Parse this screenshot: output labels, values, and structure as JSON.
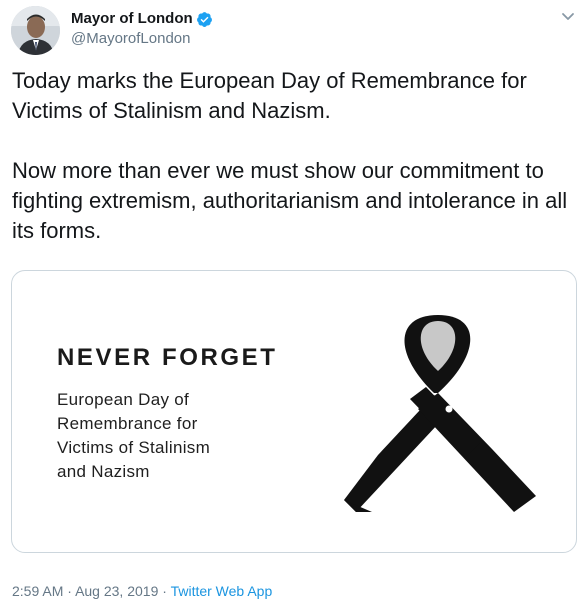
{
  "author": {
    "display_name": "Mayor of London",
    "handle": "@MayorofLondon",
    "verified": true
  },
  "icons": {
    "verified": "verified-badge-icon",
    "more": "chevron-down-icon",
    "ribbon": "black-ribbon-icon"
  },
  "tweet": {
    "paragraph_1": "Today marks the European Day of Remembrance for Victims of Stalinism and Nazism.",
    "paragraph_2": "Now more than ever we must show our commitment to fighting extremism, authoritarianism and intolerance in all its forms."
  },
  "card": {
    "headline": "NEVER FORGET",
    "subtitle_lines": [
      "European Day of",
      "Remembrance for",
      "Victims of Stalinism",
      "and Nazism"
    ]
  },
  "footer": {
    "time": "2:59 AM",
    "separator": "·",
    "date": "Aug 23, 2019",
    "source": "Twitter Web App"
  },
  "colors": {
    "text": "#14171a",
    "secondary": "#657786",
    "link": "#1b95e0",
    "verified": "#1da1f2",
    "border": "#ccd6dd"
  }
}
